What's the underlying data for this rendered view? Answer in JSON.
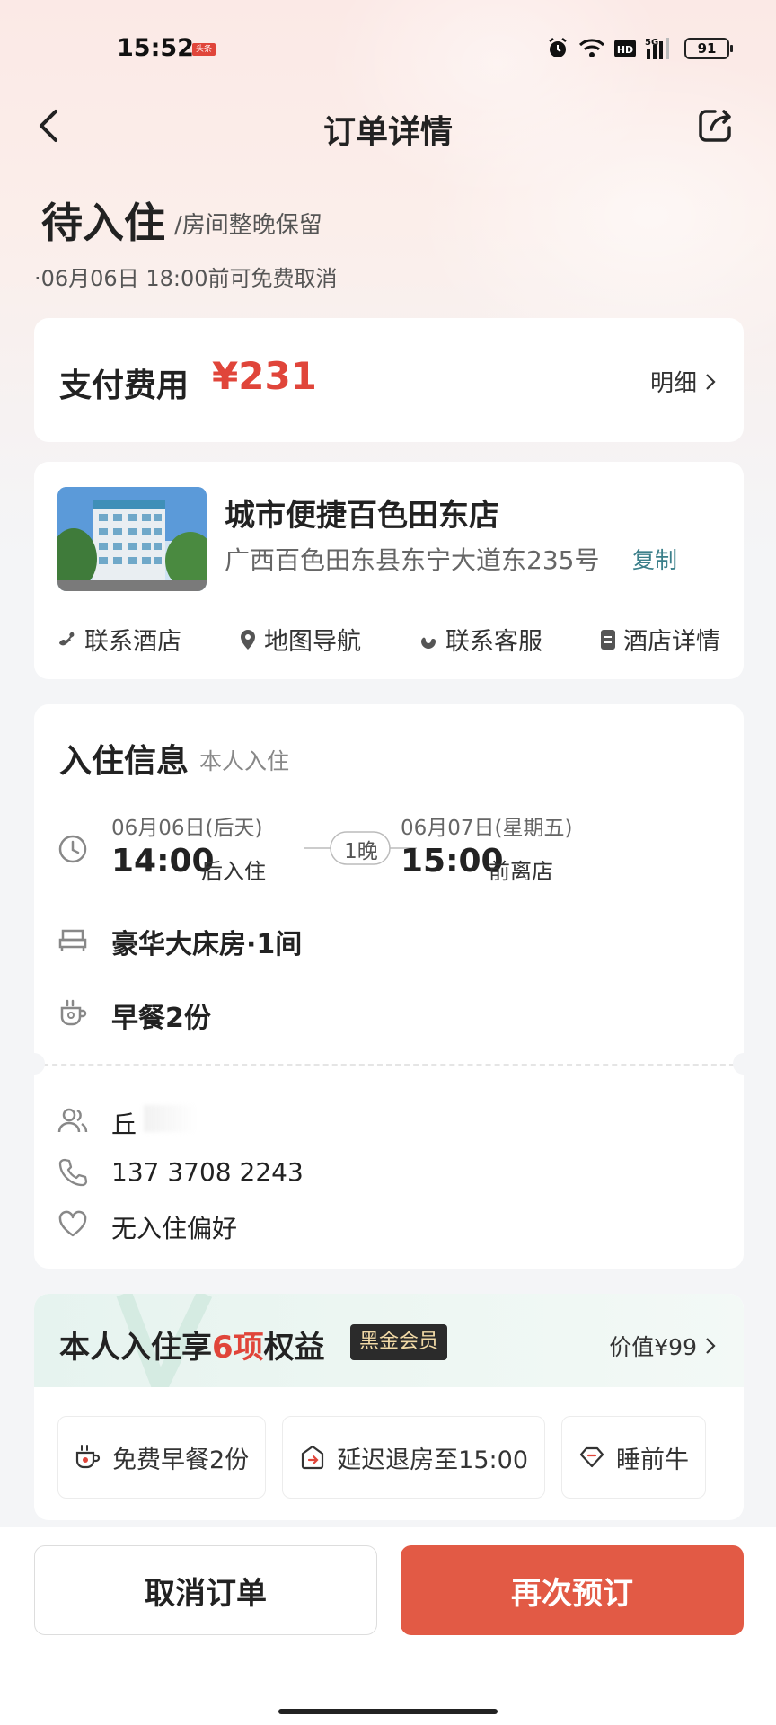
{
  "status_bar": {
    "time": "15:52",
    "badge": "头条",
    "battery": "91"
  },
  "nav": {
    "title": "订单详情"
  },
  "order_status": {
    "title": "待入住",
    "subtitle": "/房间整晚保留",
    "cancel_note": "·06月06日 18:00前可免费取消"
  },
  "payment": {
    "label": "支付费用",
    "amount": "¥231",
    "detail": "明细"
  },
  "hotel": {
    "name": "城市便捷百色田东店",
    "address": "广西百色田东县东宁大道东235号",
    "copy": "复制",
    "actions": [
      {
        "label": "联系酒店",
        "icon": "phone-icon"
      },
      {
        "label": "地图导航",
        "icon": "location-pin-icon"
      },
      {
        "label": "联系客服",
        "icon": "service-icon"
      },
      {
        "label": "酒店详情",
        "icon": "document-icon"
      }
    ]
  },
  "checkin": {
    "title": "入住信息",
    "subtitle": "本人入住",
    "checkin_date": "06月06日(后天)",
    "checkin_time": "14:00",
    "checkin_suffix": "后入住",
    "nights": "1晚",
    "checkout_date": "06月07日(星期五)",
    "checkout_time": "15:00",
    "checkout_suffix": "前离店",
    "room": "豪华大床房·1间",
    "breakfast": "早餐2份",
    "guest": "丘",
    "phone": "137 3708 2243",
    "preference": "无入住偏好"
  },
  "benefits": {
    "title_prefix": "本人入住享",
    "count": "6项",
    "title_suffix": "权益",
    "badge": "黑金会员",
    "value": "价值¥99",
    "items": [
      {
        "label": "免费早餐2份",
        "icon": "coffee-cup-icon"
      },
      {
        "label": "延迟退房至15:00",
        "icon": "late-checkout-icon"
      },
      {
        "label": "睡前牛",
        "icon": "diamond-icon"
      }
    ]
  },
  "bottom": {
    "cancel": "取消订单",
    "rebook": "再次预订"
  },
  "colors": {
    "accent": "#e0453a",
    "button": "#e25a45",
    "link": "#3b7f8a"
  }
}
